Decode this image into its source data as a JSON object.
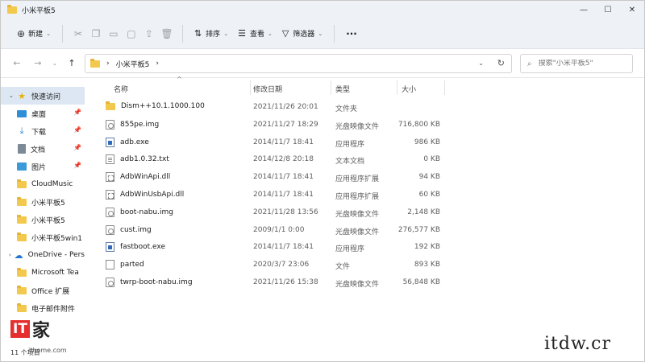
{
  "window": {
    "title": "小米平板5",
    "controls": {
      "minimize": "—",
      "maximize": "☐",
      "close": "✕"
    }
  },
  "toolbar": {
    "new_label": "新建",
    "sort_label": "排序",
    "view_label": "查看",
    "filter_label": "筛选器",
    "more_label": "···"
  },
  "nav": {
    "back": "←",
    "forward": "→",
    "recent": "⌄",
    "up": "↑"
  },
  "address": {
    "path": [
      "小米平板5"
    ],
    "refresh": "↻"
  },
  "search": {
    "placeholder": "搜索\"小米平板5\""
  },
  "sidebar": {
    "items": [
      {
        "label": "快速访问",
        "icon": "star-icon"
      },
      {
        "label": "桌面",
        "icon": "desktop-icon",
        "pinned": true
      },
      {
        "label": "下载",
        "icon": "download-icon",
        "pinned": true
      },
      {
        "label": "文档",
        "icon": "document-icon",
        "pinned": true
      },
      {
        "label": "图片",
        "icon": "picture-icon",
        "pinned": true
      },
      {
        "label": "CloudMusic",
        "icon": "folder-icon"
      },
      {
        "label": "小米平板5",
        "icon": "folder-icon"
      },
      {
        "label": "小米平板5",
        "icon": "folder-icon"
      },
      {
        "label": "小米平板5win1",
        "icon": "folder-icon"
      },
      {
        "label": "OneDrive - Pers",
        "icon": "cloud-icon"
      },
      {
        "label": "Microsoft Tea",
        "icon": "folder-icon"
      },
      {
        "label": "Office 扩展",
        "icon": "folder-icon"
      },
      {
        "label": "电子邮件附件",
        "icon": "folder-icon"
      }
    ]
  },
  "columns": {
    "name": "名称",
    "date": "修改日期",
    "type": "类型",
    "size": "大小"
  },
  "files": [
    {
      "name": "Dism++10.1.1000.100",
      "date": "2021/11/26 20:01",
      "type": "文件夹",
      "size": "",
      "icon": "folder"
    },
    {
      "name": "855pe.img",
      "date": "2021/11/27 18:29",
      "type": "光盘映像文件",
      "size": "716,800 KB",
      "icon": "disc"
    },
    {
      "name": "adb.exe",
      "date": "2014/11/7 18:41",
      "type": "应用程序",
      "size": "986 KB",
      "icon": "exe"
    },
    {
      "name": "adb1.0.32.txt",
      "date": "2014/12/8 20:18",
      "type": "文本文档",
      "size": "0 KB",
      "icon": "txt"
    },
    {
      "name": "AdbWinApi.dll",
      "date": "2014/11/7 18:41",
      "type": "应用程序扩展",
      "size": "94 KB",
      "icon": "dll"
    },
    {
      "name": "AdbWinUsbApi.dll",
      "date": "2014/11/7 18:41",
      "type": "应用程序扩展",
      "size": "60 KB",
      "icon": "dll"
    },
    {
      "name": "boot-nabu.img",
      "date": "2021/11/28 13:56",
      "type": "光盘映像文件",
      "size": "2,148 KB",
      "icon": "disc"
    },
    {
      "name": "cust.img",
      "date": "2009/1/1 0:00",
      "type": "光盘映像文件",
      "size": "276,577 KB",
      "icon": "disc"
    },
    {
      "name": "fastboot.exe",
      "date": "2014/11/7 18:41",
      "type": "应用程序",
      "size": "192 KB",
      "icon": "exe"
    },
    {
      "name": "parted",
      "date": "2020/3/7 23:06",
      "type": "文件",
      "size": "893 KB",
      "icon": "file"
    },
    {
      "name": "twrp-boot-nabu.img",
      "date": "2021/11/26 15:38",
      "type": "光盘映像文件",
      "size": "56,848 KB",
      "icon": "disc"
    }
  ],
  "status": {
    "count": "11 个项目"
  },
  "watermark": {
    "logo_text": "IT",
    "logo_zh": "家",
    "site": "ithome.com",
    "right": "itdw.cr"
  }
}
